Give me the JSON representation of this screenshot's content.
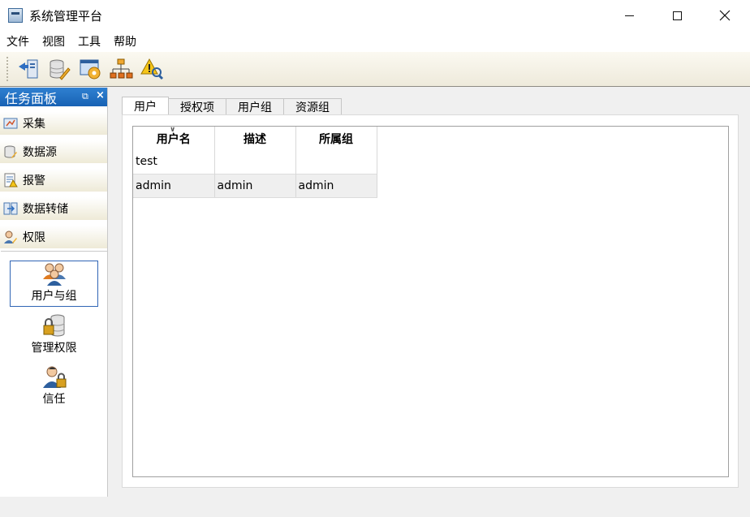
{
  "window": {
    "title": "系统管理平台"
  },
  "menu": [
    "文件",
    "视图",
    "工具",
    "帮助"
  ],
  "toolbar": [
    {
      "icon": "export-icon"
    },
    {
      "icon": "database-settings-icon"
    },
    {
      "icon": "system-config-icon"
    },
    {
      "icon": "network-topology-icon"
    },
    {
      "icon": "alarm-search-icon"
    }
  ],
  "task_panel": {
    "title": "任务面板",
    "categories": [
      {
        "label": "采集",
        "icon": "collect-icon"
      },
      {
        "label": "数据源",
        "icon": "datasource-icon"
      },
      {
        "label": "报警",
        "icon": "alarm-icon"
      },
      {
        "label": "数据转储",
        "icon": "data-dump-icon"
      },
      {
        "label": "权限",
        "icon": "permission-icon"
      }
    ],
    "items": [
      {
        "label": "用户与组",
        "icon": "users-groups-icon",
        "selected": true
      },
      {
        "label": "管理权限",
        "icon": "manage-permission-icon",
        "selected": false
      },
      {
        "label": "信任",
        "icon": "trust-icon",
        "selected": false
      }
    ]
  },
  "tabs": [
    "用户",
    "授权项",
    "用户组",
    "资源组"
  ],
  "active_tab": "用户",
  "table": {
    "columns": [
      "用户名",
      "描述",
      "所属组"
    ],
    "rows": [
      [
        "test",
        "",
        ""
      ],
      [
        "admin",
        "admin",
        "admin"
      ]
    ]
  }
}
